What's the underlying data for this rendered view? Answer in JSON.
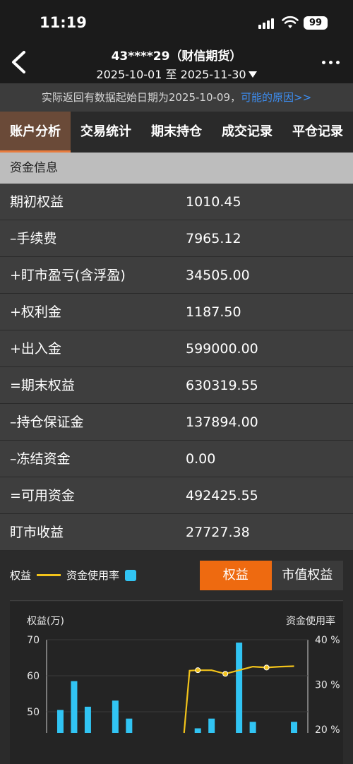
{
  "status": {
    "time": "11:19",
    "battery": "99"
  },
  "header": {
    "title": "43****29（财信期货）",
    "date_range": "2025-10-01 至 2025-11-30"
  },
  "notice": {
    "text": "实际返回有数据起始日期为2025-10-09，",
    "link": "可能的原因>>"
  },
  "tabs": [
    {
      "label": "账户分析",
      "active": true
    },
    {
      "label": "交易统计",
      "active": false
    },
    {
      "label": "期末持仓",
      "active": false
    },
    {
      "label": "成交记录",
      "active": false
    },
    {
      "label": "平仓记录",
      "active": false
    }
  ],
  "fund_info": {
    "section_title": "资金信息",
    "rows": [
      {
        "label": "期初权益",
        "value": "1010.45"
      },
      {
        "label": "–手续费",
        "value": "7965.12"
      },
      {
        "label": "+盯市盈亏(含浮盈)",
        "value": "34505.00"
      },
      {
        "label": "+权利金",
        "value": "1187.50"
      },
      {
        "label": "+出入金",
        "value": "599000.00"
      },
      {
        "label": "=期末权益",
        "value": "630319.55"
      },
      {
        "label": "–持仓保证金",
        "value": "137894.00"
      },
      {
        "label": "–冻结资金",
        "value": "0.00"
      },
      {
        "label": "=可用资金",
        "value": "492425.55"
      },
      {
        "label": "盯市收益",
        "value": "27727.38"
      }
    ]
  },
  "chart_panel": {
    "legend_equity": "权益",
    "legend_usage": "资金使用率",
    "toggle": [
      {
        "label": "权益",
        "active": true
      },
      {
        "label": "市值权益",
        "active": false
      }
    ],
    "colors": {
      "line": "#f2c31a",
      "bar": "#31c4f3",
      "toggle_active": "#ee6a10"
    }
  },
  "chart_data": {
    "type": "bar",
    "left_axis_label": "权益(万)",
    "right_axis_label": "资金使用率",
    "left_ticks": [
      "70",
      "60",
      "50"
    ],
    "right_ticks": [
      "40 %",
      "30 %",
      "20 %"
    ],
    "ylim_left": [
      47,
      70
    ],
    "ylim_right": [
      20,
      40
    ],
    "bars": [
      {
        "x": 1,
        "value": 50.5
      },
      {
        "x": 2,
        "value": 58.5
      },
      {
        "x": 3,
        "value": 51.4
      },
      {
        "x": 5,
        "value": 53.1
      },
      {
        "x": 6,
        "value": 48.1
      },
      {
        "x": 11,
        "value": 45.4
      },
      {
        "x": 12,
        "value": 48.1
      },
      {
        "x": 14,
        "value": 69.2
      },
      {
        "x": 15,
        "value": 47.2
      },
      {
        "x": 18,
        "value": 47.2
      }
    ],
    "line": [
      {
        "x": 10,
        "value": 19
      },
      {
        "x": 10.4,
        "value": 33.1
      },
      {
        "x": 11,
        "value": 33.2
      },
      {
        "x": 12,
        "value": 33.2
      },
      {
        "x": 13,
        "value": 32.4
      },
      {
        "x": 14,
        "value": 33.2
      },
      {
        "x": 15,
        "value": 34.0
      },
      {
        "x": 16,
        "value": 33.8
      },
      {
        "x": 17,
        "value": 34.0
      },
      {
        "x": 18,
        "value": 34.1
      }
    ],
    "line_markers_x": [
      11,
      13,
      16
    ]
  }
}
